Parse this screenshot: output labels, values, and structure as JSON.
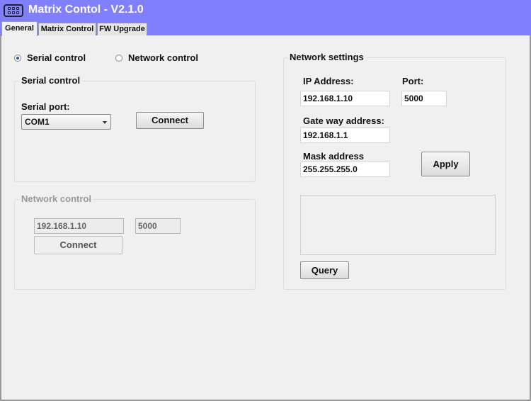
{
  "window": {
    "title": "Matrix Contol - V2.1.0",
    "icon": "matrix-grid-icon",
    "accent_color": "#8080ff"
  },
  "tabs": [
    {
      "label": "General",
      "active": true
    },
    {
      "label": "Matrix Control",
      "active": false
    },
    {
      "label": "FW Upgrade",
      "active": false
    }
  ],
  "mode": {
    "serial_label": "Serial control",
    "network_label": "Network control",
    "selected": "serial"
  },
  "serial_group": {
    "legend": "Serial control",
    "port_label": "Serial port:",
    "port_value": "COM1",
    "connect_label": "Connect"
  },
  "network_group": {
    "legend": "Network control",
    "ip_value": "192.168.1.10",
    "port_value": "5000",
    "connect_label": "Connect",
    "disabled": true
  },
  "network_settings": {
    "legend": "Network settings",
    "ip_label": "IP Address:",
    "ip_value": "192.168.1.10",
    "port_label": "Port:",
    "port_value": "5000",
    "gateway_label": "Gate way address:",
    "gateway_value": "192.168.1.1",
    "mask_label": "Mask address",
    "mask_value": "255.255.255.0",
    "apply_label": "Apply",
    "output_text": "",
    "query_label": "Query"
  }
}
